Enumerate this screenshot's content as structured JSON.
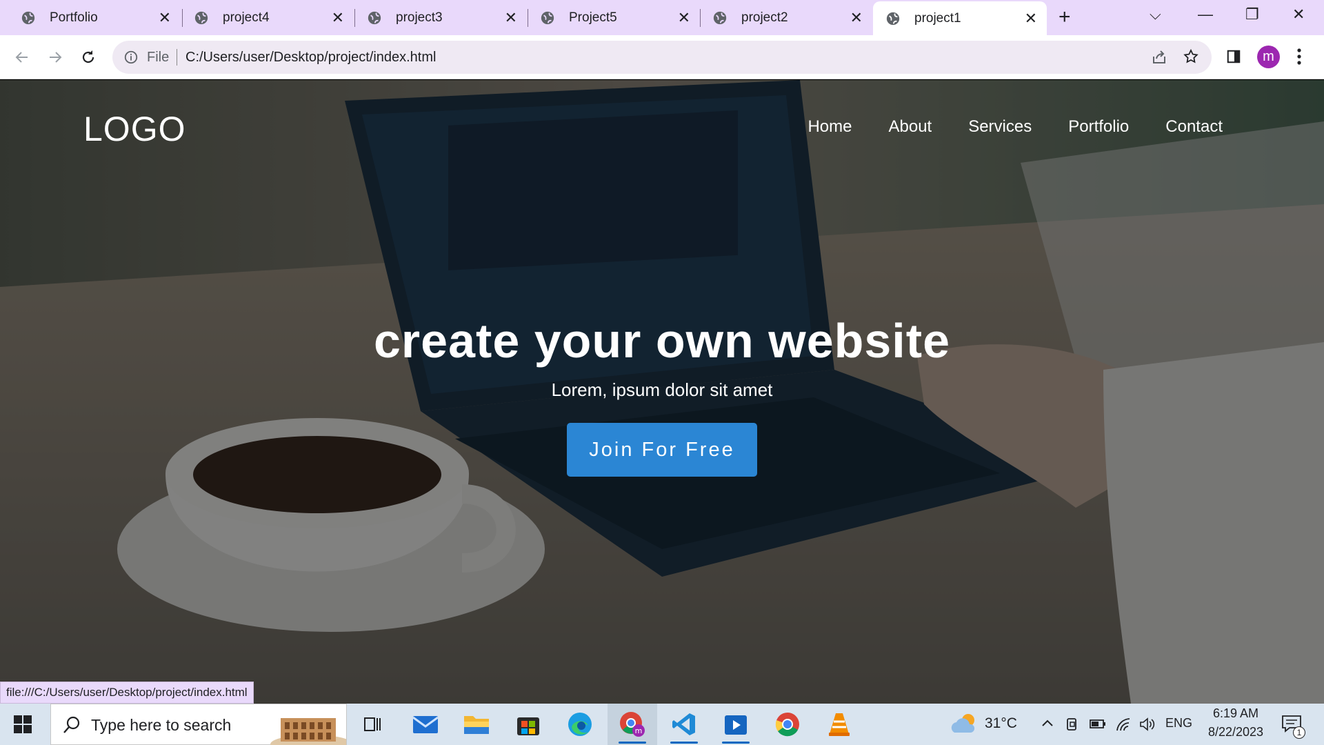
{
  "browser": {
    "tabs": [
      {
        "title": "Portfolio",
        "active": false
      },
      {
        "title": "project4",
        "active": false
      },
      {
        "title": "project3",
        "active": false
      },
      {
        "title": "Project5",
        "active": false
      },
      {
        "title": "project2",
        "active": false
      },
      {
        "title": "project1",
        "active": true
      }
    ],
    "new_tab_glyph": "+",
    "window_controls": {
      "tab_search": "⌵",
      "minimize": "—",
      "restore": "❐",
      "close": "✕"
    },
    "address": {
      "scheme_label": "File",
      "url": "C:/Users/user/Desktop/project/index.html"
    },
    "profile_initial": "m",
    "accent_color": "#e9d9fb"
  },
  "site": {
    "logo": "LOGO",
    "nav": [
      "Home",
      "About",
      "Services",
      "Portfolio",
      "Contact"
    ],
    "hero": {
      "title": "create your own website",
      "subtitle": "Lorem, ipsum dolor sit amet",
      "cta": "Join For Free",
      "cta_color": "#2b86d4"
    }
  },
  "status_bar_url": "file:///C:/Users/user/Desktop/project/index.html",
  "taskbar": {
    "search_placeholder": "Type here to search",
    "apps": [
      "task-view",
      "mail",
      "file-explorer",
      "microsoft-store",
      "edge",
      "chrome-profile",
      "vscode",
      "media-player",
      "chrome",
      "vlc"
    ],
    "weather": "31°C",
    "language": "ENG",
    "time": "6:19 AM",
    "date": "8/22/2023",
    "notification_count": "1"
  }
}
